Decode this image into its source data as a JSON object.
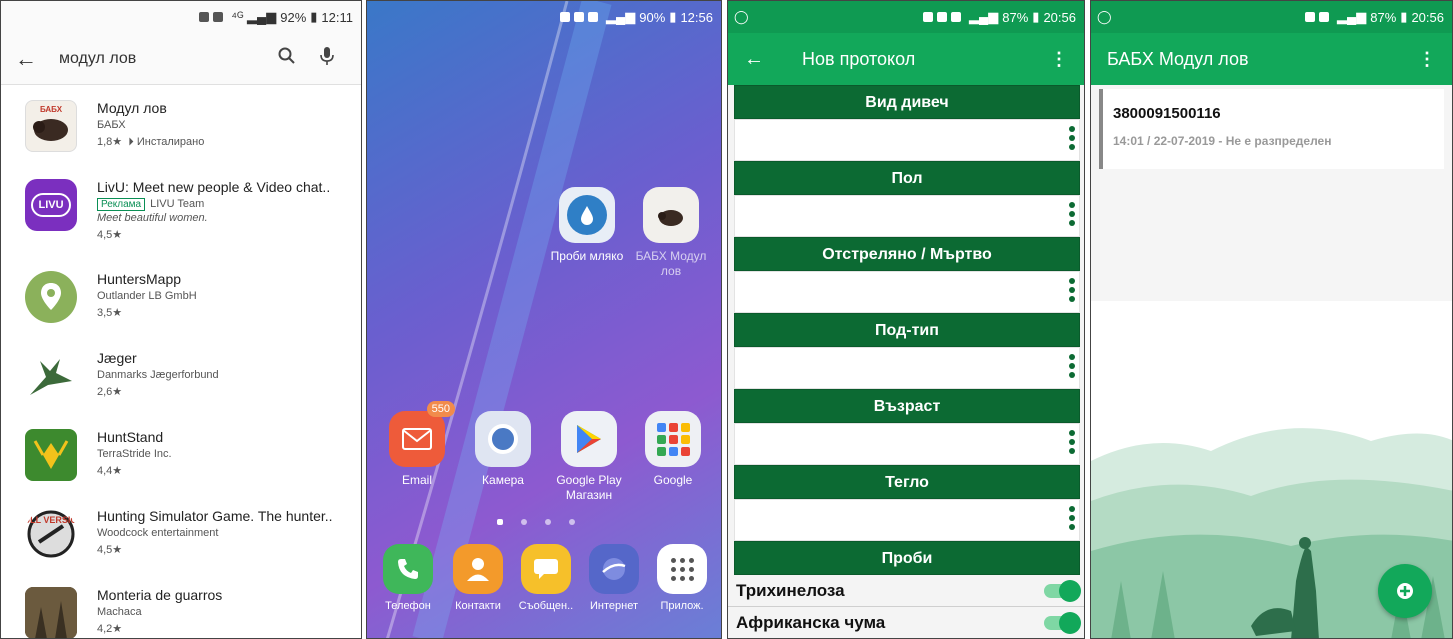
{
  "panel1": {
    "status": {
      "battery": "92%",
      "time": "12:11"
    },
    "query": "модул лов",
    "apps": [
      {
        "title": "Модул лов",
        "dev": "БАБХ",
        "rating": "1,8★",
        "extra": "Инсталирано"
      },
      {
        "title": "LivU: Meet new people & Video chat..",
        "ad": "Реклама",
        "dev": "LIVU Team",
        "desc": "Meet beautiful women.",
        "rating": "4,5★"
      },
      {
        "title": "HuntersMapp",
        "dev": "Outlander LB GmbH",
        "rating": "3,5★"
      },
      {
        "title": "Jæger",
        "dev": "Danmarks Jægerforbund",
        "rating": "2,6★"
      },
      {
        "title": "HuntStand",
        "dev": "TerraStride Inc.",
        "rating": "4,4★"
      },
      {
        "title": "Hunting Simulator Game. The hunter..",
        "dev": "Woodcock entertainment",
        "rating": "4,5★"
      },
      {
        "title": "Monteria de guarros",
        "dev": "Machaca",
        "rating": "4,2★"
      }
    ],
    "logo_texts": {
      "livu": "LIVU",
      "full_version": "FULL VERSION",
      "bapx": "БАБХ"
    }
  },
  "panel2": {
    "status": {
      "battery": "90%",
      "time": "12:56"
    },
    "apps": {
      "probi": "Проби мляко",
      "babh": "БАБХ Модул лов",
      "email": "Email",
      "email_badge": "550",
      "camera": "Камера",
      "play": "Google Play Магазин",
      "google": "Google"
    },
    "dock": [
      "Телефон",
      "Контакти",
      "Съобщен..",
      "Интернет",
      "Прилож."
    ]
  },
  "panel3": {
    "status": {
      "battery": "87%",
      "time": "20:56"
    },
    "title": "Нов протокол",
    "sections": [
      "Вид дивеч",
      "Пол",
      "Отстреляно / Мъртво",
      "Под-тип",
      "Възраст",
      "Тегло"
    ],
    "tests_header": "Проби",
    "tests": [
      "Трихинелоза",
      "Африканска чума"
    ]
  },
  "panel4": {
    "status": {
      "battery": "87%",
      "time": "20:56"
    },
    "title": "БАБХ Модул лов",
    "card": {
      "number": "3800091500116",
      "meta": "14:01 / 22-07-2019 - Не е разпределен"
    }
  },
  "colors": {
    "green": "#12a85a",
    "dark_green": "#0c6a33"
  }
}
